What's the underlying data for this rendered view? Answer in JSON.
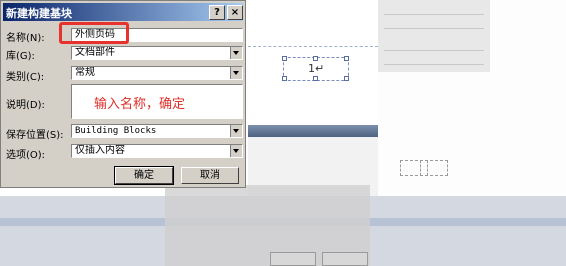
{
  "dialog": {
    "title": "新建构建基块",
    "help_label": "?",
    "close_label": "×",
    "fields": {
      "name_label": "名称(N):",
      "name_value": "外侧页码",
      "gallery_label": "库(G):",
      "gallery_value": "文档部件",
      "category_label": "类别(C):",
      "category_value": "常规",
      "description_label": "说明(D):",
      "description_value": "",
      "save_in_label": "保存位置(S):",
      "save_in_value": "Building Blocks",
      "options_label": "选项(O):",
      "options_value": "仅插入内容"
    },
    "ok_label": "确定",
    "cancel_label": "取消"
  },
  "annotation": {
    "text": "输入名称，确定",
    "color": "#e0302a"
  },
  "document": {
    "page_number_text": "1↵"
  }
}
